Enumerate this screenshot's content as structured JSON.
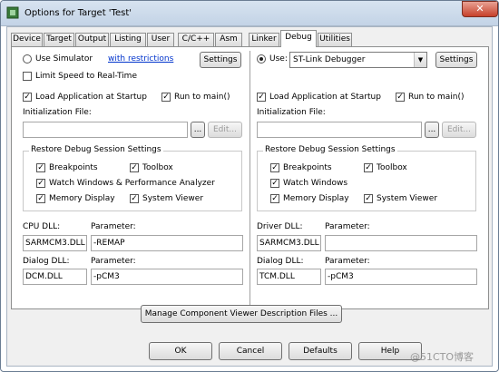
{
  "window": {
    "title": "Options for Target 'Test'",
    "close": "✕"
  },
  "tabs": [
    "Device",
    "Target",
    "Output",
    "Listing",
    "User",
    "C/C++",
    "Asm",
    "Linker",
    "Debug",
    "Utilities"
  ],
  "active_tab": "Debug",
  "left": {
    "use_simulator": "Use Simulator",
    "with_restrictions": "with restrictions",
    "settings": "Settings",
    "limit_speed": "Limit Speed to Real-Time",
    "load_app": "Load Application at Startup",
    "run_main": "Run to main()",
    "init_file": "Initialization File:",
    "browse": "...",
    "edit": "Edit...",
    "restore_group": "Restore Debug Session Settings",
    "breakpoints": "Breakpoints",
    "toolbox": "Toolbox",
    "watch_windows": "Watch Windows & Performance Analyzer",
    "memory_display": "Memory Display",
    "system_viewer": "System Viewer",
    "cpu_dll_label": "CPU DLL:",
    "cpu_param_label": "Parameter:",
    "cpu_dll": "SARMCM3.DLL",
    "cpu_param": "-REMAP",
    "dialog_dll_label": "Dialog DLL:",
    "dialog_param_label": "Parameter:",
    "dialog_dll": "DCM.DLL",
    "dialog_param": "-pCM3"
  },
  "right": {
    "use": "Use:",
    "debugger": "ST-Link Debugger",
    "settings": "Settings",
    "load_app": "Load Application at Startup",
    "run_main": "Run to main()",
    "init_file": "Initialization File:",
    "browse": "...",
    "edit": "Edit...",
    "restore_group": "Restore Debug Session Settings",
    "breakpoints": "Breakpoints",
    "toolbox": "Toolbox",
    "watch_windows": "Watch Windows",
    "memory_display": "Memory Display",
    "system_viewer": "System Viewer",
    "driver_dll_label": "Driver DLL:",
    "driver_param_label": "Parameter:",
    "driver_dll": "SARMCM3.DLL",
    "driver_param": "",
    "dialog_dll_label": "Dialog DLL:",
    "dialog_param_label": "Parameter:",
    "dialog_dll": "TCM.DLL",
    "dialog_param": "-pCM3"
  },
  "manage_button": "Manage Component Viewer Description Files ...",
  "footer": {
    "ok": "OK",
    "cancel": "Cancel",
    "defaults": "Defaults",
    "help": "Help"
  },
  "checkmark": "✓",
  "watermark": "@51CTO博客"
}
